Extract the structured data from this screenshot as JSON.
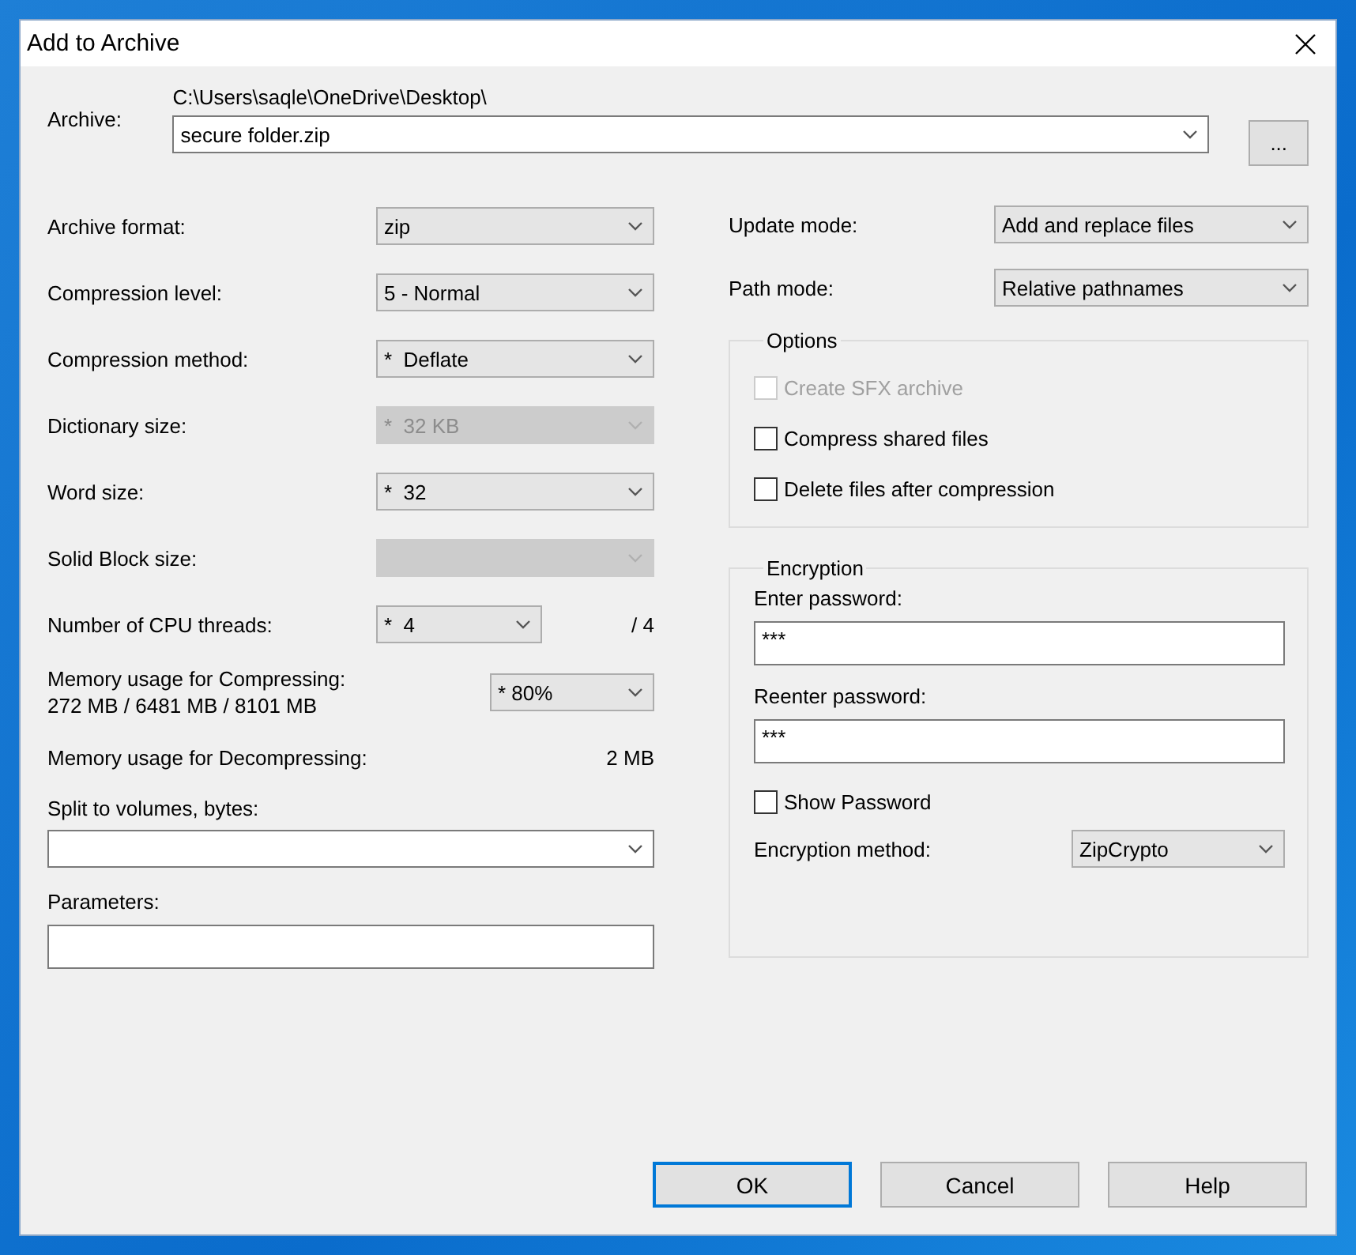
{
  "window": {
    "title": "Add to Archive"
  },
  "archive": {
    "label": "Archive:",
    "path": "C:\\Users\\saqle\\OneDrive\\Desktop\\",
    "value": "secure folder.zip",
    "browse": "..."
  },
  "settings": [
    {
      "label": "Archive format:",
      "value": "zip",
      "disabled": false
    },
    {
      "label": "Compression level:",
      "value": "5 - Normal",
      "disabled": false
    },
    {
      "label": "Compression method:",
      "value": "*  Deflate",
      "disabled": false
    },
    {
      "label": "Dictionary size:",
      "value": "*  32 KB",
      "disabled": true
    },
    {
      "label": "Word size:",
      "value": "*  32",
      "disabled": false
    },
    {
      "label": "Solid Block size:",
      "disabled": true
    }
  ],
  "cpu_threads": {
    "label": "Number of CPU threads:",
    "value": "*  4",
    "max": "/ 4"
  },
  "memory_compress": {
    "label": "Memory usage for Compressing:",
    "usage": "272 MB / 6481 MB / 8101 MB",
    "value": "* 80%"
  },
  "memory_decompress": {
    "label": "Memory usage for Decompressing:",
    "value": "2 MB"
  },
  "split": {
    "label": "Split to volumes, bytes:"
  },
  "parameters": {
    "label": "Parameters:"
  },
  "update_mode": {
    "label": "Update mode:",
    "value": "Add and replace files"
  },
  "path_mode": {
    "label": "Path mode:",
    "value": "Relative pathnames"
  },
  "options": {
    "title": "Options",
    "items": [
      {
        "label": "Create SFX archive",
        "checked": false,
        "disabled": true
      },
      {
        "label": "Compress shared files",
        "checked": false,
        "disabled": false
      },
      {
        "label": "Delete files after compression",
        "checked": false,
        "disabled": false
      }
    ]
  },
  "encryption": {
    "title": "Encryption",
    "password_label": "Enter password:",
    "password": "***",
    "reenter_label": "Reenter password:",
    "reenter": "***",
    "show_password": {
      "label": "Show Password",
      "checked": false
    },
    "method_label": "Encryption method:",
    "method": "ZipCrypto"
  },
  "buttons": [
    {
      "label": "OK",
      "default": true
    },
    {
      "label": "Cancel",
      "default": false
    },
    {
      "label": "Help",
      "default": false
    }
  ]
}
